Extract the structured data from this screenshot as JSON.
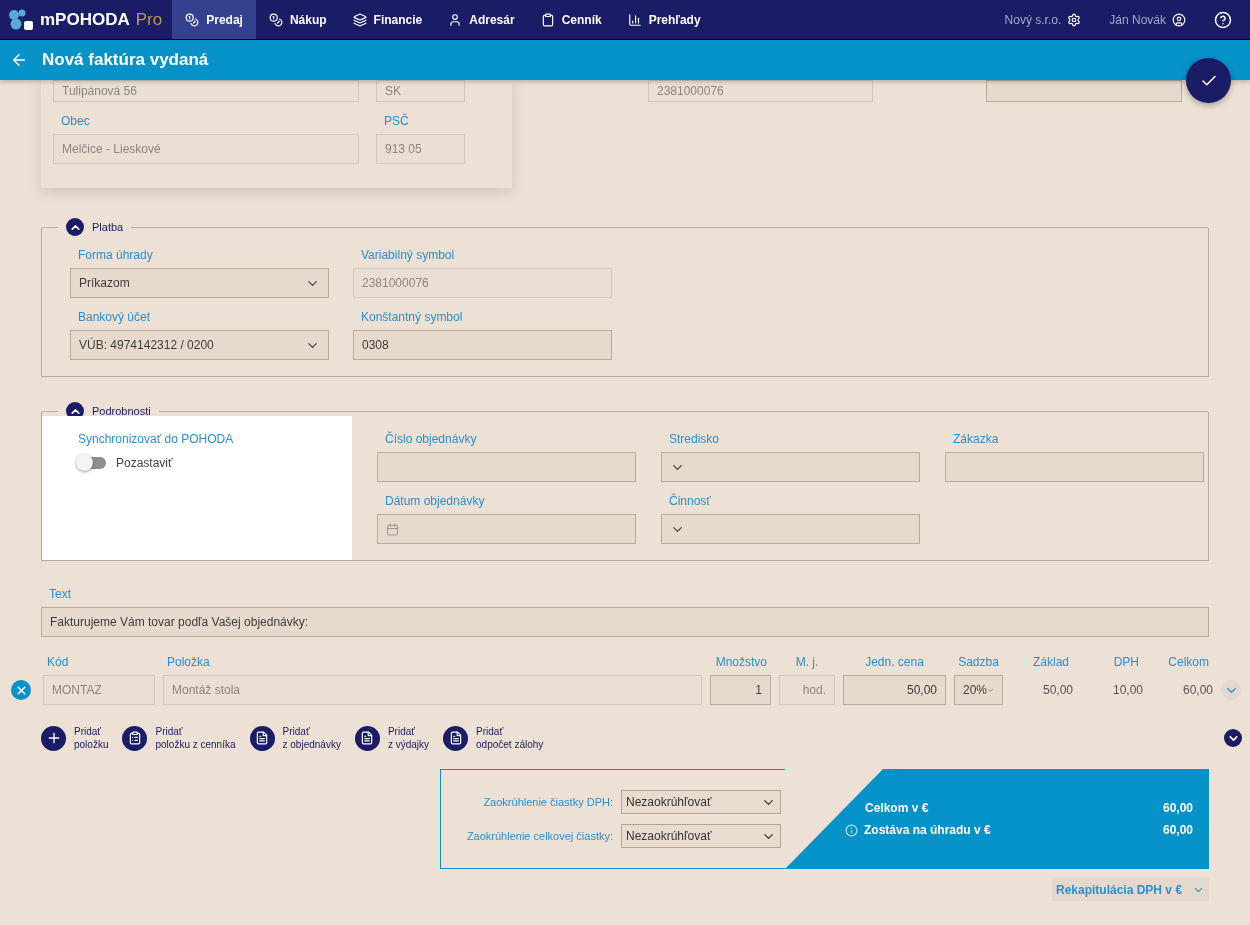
{
  "app": {
    "name": "mPOHODA",
    "edition": "Pro"
  },
  "nav": [
    {
      "label": "Predaj",
      "selected": true
    },
    {
      "label": "Nákup",
      "selected": false
    },
    {
      "label": "Financie",
      "selected": false
    },
    {
      "label": "Adresár",
      "selected": false
    },
    {
      "label": "Cenník",
      "selected": false
    },
    {
      "label": "Prehľady",
      "selected": false
    }
  ],
  "company": "Nový s.r.o.",
  "user": "Ján Novák",
  "header": {
    "title": "Nová faktúra vydaná"
  },
  "address": {
    "rows": [
      [
        {
          "value": "Tulipánová 56"
        },
        {
          "value": "SK"
        }
      ],
      [
        {
          "label": "Obec",
          "value": "Melčice - Lieskové"
        },
        {
          "label": "PSČ",
          "value": "913 05"
        }
      ]
    ],
    "side_fields": [
      {
        "value": "2381000076",
        "disabled": true
      },
      {
        "disabled": false
      }
    ]
  },
  "platba": {
    "title": "Platba",
    "expanded": true,
    "fields": [
      {
        "label": "Forma úhrady",
        "value": "Príkazom",
        "kind": "select",
        "disabled": false
      },
      {
        "label": "Variabilný symbol",
        "value": "2381000076",
        "kind": "text",
        "disabled": true
      },
      {
        "label": "Bankový účet",
        "value": "VÚB: 4974142312 / 0200",
        "kind": "select",
        "disabled": false
      },
      {
        "label": "Konštantný symbol",
        "value": "0308",
        "kind": "text",
        "disabled": false
      }
    ]
  },
  "podrobnosti": {
    "title": "Podrobnosti",
    "expanded": true,
    "sync": {
      "label": "Synchronizovať do POHODA",
      "toggle_label": "Pozastaviť",
      "on": false
    },
    "fields": [
      {
        "label": "Číslo objednávky",
        "kind": "text",
        "disabled": false
      },
      {
        "label": "Stredisko",
        "kind": "select",
        "disabled": false
      },
      {
        "label": "Zákazka",
        "kind": "text",
        "disabled": false
      },
      {
        "label": "Dátum objednávky",
        "kind": "date",
        "disabled": false
      },
      {
        "label": "Činnosť",
        "kind": "select",
        "disabled": false
      }
    ]
  },
  "text": {
    "label": "Text",
    "value": "Fakturujeme Vám tovar podľa Vašej objednávky:"
  },
  "items": {
    "columns": [
      "Kód",
      "Položka",
      "Množstvo",
      "M. j.",
      "Jedn. cena",
      "Sadzba",
      "Základ",
      "DPH",
      "Celkom"
    ],
    "rows": [
      {
        "cells": [
          {
            "value": "MONTAZ",
            "kind": "text",
            "disabled": true
          },
          {
            "value": "Montáž stola",
            "kind": "text",
            "disabled": true
          },
          {
            "value": "1",
            "kind": "number",
            "disabled": false
          },
          {
            "value": "hod.",
            "kind": "number",
            "disabled": true
          },
          {
            "value": "50,00",
            "kind": "number",
            "disabled": false
          },
          {
            "value": "20%",
            "kind": "select",
            "disabled": false
          },
          {
            "value": "50,00",
            "kind": "plain"
          },
          {
            "value": "10,00",
            "kind": "plain"
          },
          {
            "value": "60,00",
            "kind": "plain"
          }
        ]
      }
    ]
  },
  "actions": [
    {
      "label": "Pridať\npoložku",
      "kind": "plus"
    },
    {
      "label": "Pridať\npoložku z cenníka",
      "kind": "pricelist"
    },
    {
      "label": "Pridať\nz objednávky",
      "kind": "doc"
    },
    {
      "label": "Pridať\nz výdajky",
      "kind": "doc"
    },
    {
      "label": "Pridať\nodpočet zálohy",
      "kind": "doc"
    }
  ],
  "rounding": [
    {
      "label": "Zaokrúhlenie čiastky DPH:",
      "value": "Nezaokrúhľovať"
    },
    {
      "label": "Zaokrúhlenie celkovej čiastky:",
      "value": "Nezaokrúhľovať"
    }
  ],
  "totals": [
    {
      "label": "Celkom v €",
      "value": "60,00",
      "info": false
    },
    {
      "label": "Zostáva na úhradu v €",
      "value": "60,00",
      "info": true
    }
  ],
  "recap": {
    "label": "Rekapitulácia DPH v €",
    "expanded": false
  }
}
